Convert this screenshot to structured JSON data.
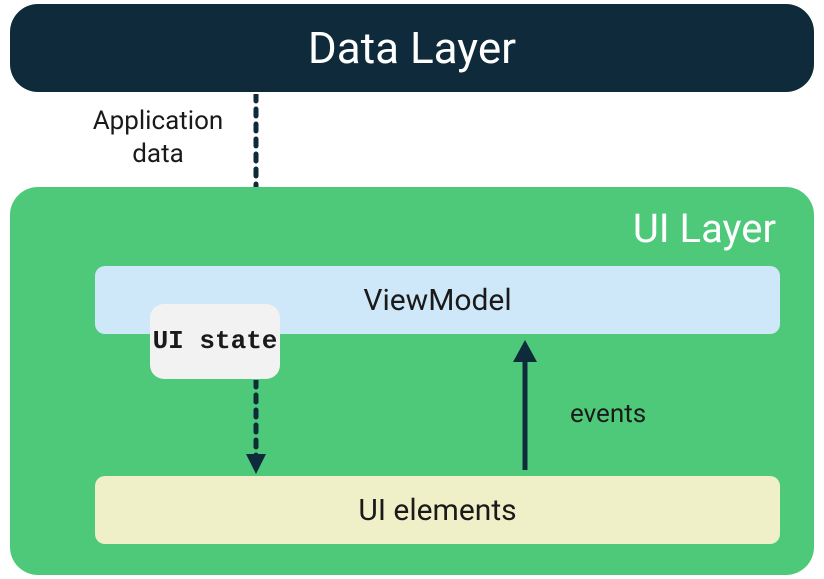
{
  "dataLayer": {
    "title": "Data Layer"
  },
  "labels": {
    "appData": "Application data",
    "events": "events"
  },
  "uiLayer": {
    "title": "UI Layer",
    "viewModel": "ViewModel",
    "uiState": "UI state",
    "uiElements": "UI elements"
  },
  "colors": {
    "dataLayerBg": "#0f2a3a",
    "uiLayerBg": "#4dc979",
    "viewModelBg": "#cfe8f9",
    "uiStateBg": "#f2f2f2",
    "uiElementsBg": "#f0f0c8",
    "arrowColor": "#0f2a3a"
  }
}
